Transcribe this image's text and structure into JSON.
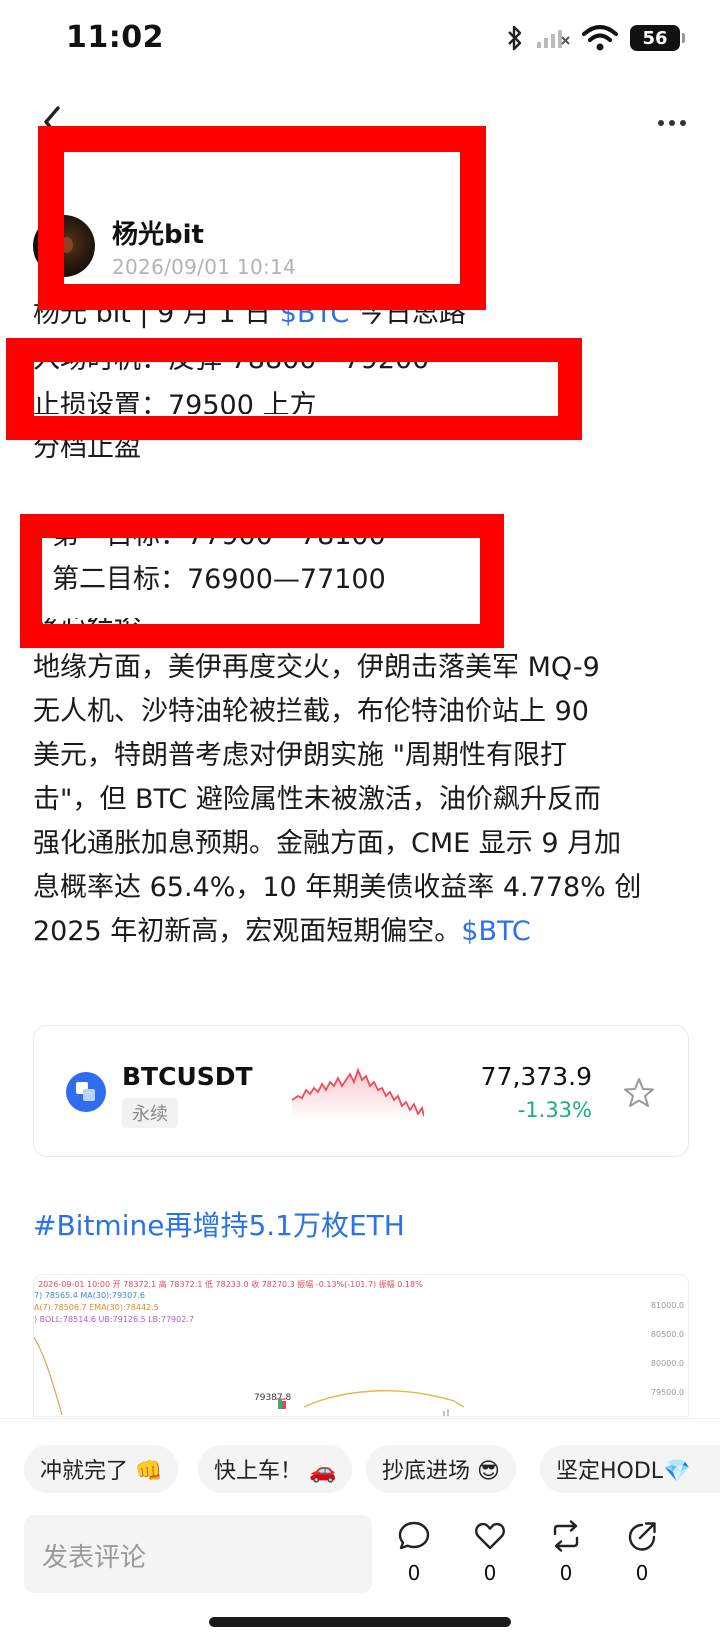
{
  "status_bar": {
    "time": "11:02",
    "battery": "56"
  },
  "author": {
    "name": "杨光bit",
    "timestamp": "2026/09/01 10:14"
  },
  "post": {
    "title_prefix": "杨光 bit | 9 月 1 日 ",
    "title_link": "$BTC",
    "title_suffix": " 今日思路",
    "entry": "入场时机：反弹 78800—79200",
    "stop_loss": "止损设置：79500 上方",
    "take_profit_heading": "分档止盈",
    "target_1": "第一目标：77900—78100",
    "target_2": "第二目标：76900—77100",
    "conclusion_heading": "核心结论",
    "body_lines": [
      "地缘方面，美伊再度交火，伊朗击落美军 MQ-9",
      "无人机、沙特油轮被拦截，布伦特油价站上 90",
      "美元，特朗普考虑对伊朗实施 \"周期性有限打",
      "击\"，但 BTC 避险属性未被激活，油价飙升反而",
      "强化通胀加息预期。金融方面，CME 显示 9 月加",
      "息概率达 65.4%，10 年期美债收益率 4.778% 创"
    ],
    "last_line": "2025 年初新高，宏观面短期偏空。",
    "last_link": "$BTC"
  },
  "ticker": {
    "symbol": "BTCUSDT",
    "tag": "永续",
    "price": "77,373.9",
    "change": "-1.33%",
    "change_color": "#18b07a",
    "icon": "star-icon"
  },
  "hashtag": "#Bitmine再增持5.1万枚ETH",
  "chart_preview": {
    "row1": "2026-09-01 10:00  开 78372.1  高 78372.1  低 78233.0  收 78270.3  振幅 -0.13%(-101.7)  振幅 0.18%",
    "row2": "7) 78565.4   MA(30):79307.6",
    "row3": "A(7):78506.7   EMA(30):78442.5",
    "row4": ")   BOLL:78514.6   UB:79126.5   LB:77902.7",
    "axis": [
      "81000.0",
      "80500.0",
      "80000.0",
      "79500.0"
    ],
    "price_label": "79387.8"
  },
  "quick_replies": [
    "冲就完了 👊",
    "快上车！ 🚗",
    "抄底进场 😎",
    "坚定HODL💎"
  ],
  "comment_placeholder": "发表评论",
  "actions": [
    {
      "icon": "comment-icon",
      "count": "0"
    },
    {
      "icon": "like-icon",
      "count": "0"
    },
    {
      "icon": "repost-icon",
      "count": "0"
    },
    {
      "icon": "share-icon",
      "count": "0"
    }
  ],
  "accent_color": "#2a72e8",
  "redaction_color": "#ff0000"
}
